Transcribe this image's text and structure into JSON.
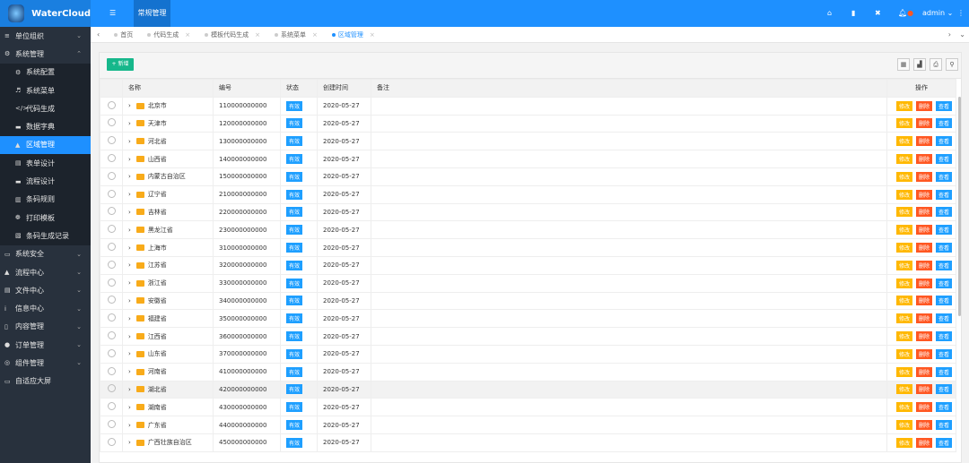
{
  "app": {
    "name": "WaterCloud",
    "top_tab": "常规管理",
    "user": "admin"
  },
  "sidebar": [
    {
      "label": "单位组织",
      "icon": "≡",
      "chev": "⌄"
    },
    {
      "label": "系统管理",
      "icon": "⚙",
      "chev": "⌃",
      "children": [
        {
          "label": "系统配置",
          "icon": "⚙"
        },
        {
          "label": "系统菜单",
          "icon": "♬"
        },
        {
          "label": "代码生成",
          "icon": "</>"
        },
        {
          "label": "数据字典",
          "icon": "▬"
        },
        {
          "label": "区域管理",
          "icon": "▲",
          "active": true
        },
        {
          "label": "表单设计",
          "icon": "▤"
        },
        {
          "label": "流程设计",
          "icon": "▬"
        },
        {
          "label": "条码规则",
          "icon": "▥"
        },
        {
          "label": "打印模板",
          "icon": "❁"
        },
        {
          "label": "条码生成记录",
          "icon": "▧"
        }
      ]
    },
    {
      "label": "系统安全",
      "icon": "▭",
      "chev": "⌄"
    },
    {
      "label": "流程中心",
      "icon": "▲",
      "chev": "⌄"
    },
    {
      "label": "文件中心",
      "icon": "▤",
      "chev": "⌄"
    },
    {
      "label": "信息中心",
      "icon": "i",
      "chev": "⌄"
    },
    {
      "label": "内容管理",
      "icon": "▯",
      "chev": "⌄"
    },
    {
      "label": "订单管理",
      "icon": "●",
      "chev": "⌄"
    },
    {
      "label": "组件管理",
      "icon": "◎",
      "chev": "⌄"
    },
    {
      "label": "自适应大屏",
      "icon": "▭"
    }
  ],
  "page_tabs": [
    {
      "label": "首页"
    },
    {
      "label": "代码生成"
    },
    {
      "label": "模板代码生成"
    },
    {
      "label": "系统菜单"
    },
    {
      "label": "区域管理",
      "active": true
    }
  ],
  "toolbar": {
    "add": "+ 新增"
  },
  "table": {
    "headers": [
      "名称",
      "编号",
      "状态",
      "创建时间",
      "备注",
      "操作"
    ],
    "actions": [
      "修改",
      "删除",
      "查看"
    ],
    "rows": [
      [
        "北京市",
        "110000000000"
      ],
      [
        "天津市",
        "120000000000"
      ],
      [
        "河北省",
        "130000000000"
      ],
      [
        "山西省",
        "140000000000"
      ],
      [
        "内蒙古自治区",
        "150000000000"
      ],
      [
        "辽宁省",
        "210000000000"
      ],
      [
        "吉林省",
        "220000000000"
      ],
      [
        "黑龙江省",
        "230000000000"
      ],
      [
        "上海市",
        "310000000000"
      ],
      [
        "江苏省",
        "320000000000"
      ],
      [
        "浙江省",
        "330000000000"
      ],
      [
        "安徽省",
        "340000000000"
      ],
      [
        "福建省",
        "350000000000"
      ],
      [
        "江西省",
        "360000000000"
      ],
      [
        "山东省",
        "370000000000"
      ],
      [
        "河南省",
        "410000000000"
      ],
      [
        "湖北省",
        "420000000000"
      ],
      [
        "湖南省",
        "430000000000"
      ],
      [
        "广东省",
        "440000000000"
      ],
      [
        "广西壮族自治区",
        "450000000000"
      ]
    ],
    "status": "有效",
    "date": "2020-05-27",
    "hover_row": 16
  }
}
